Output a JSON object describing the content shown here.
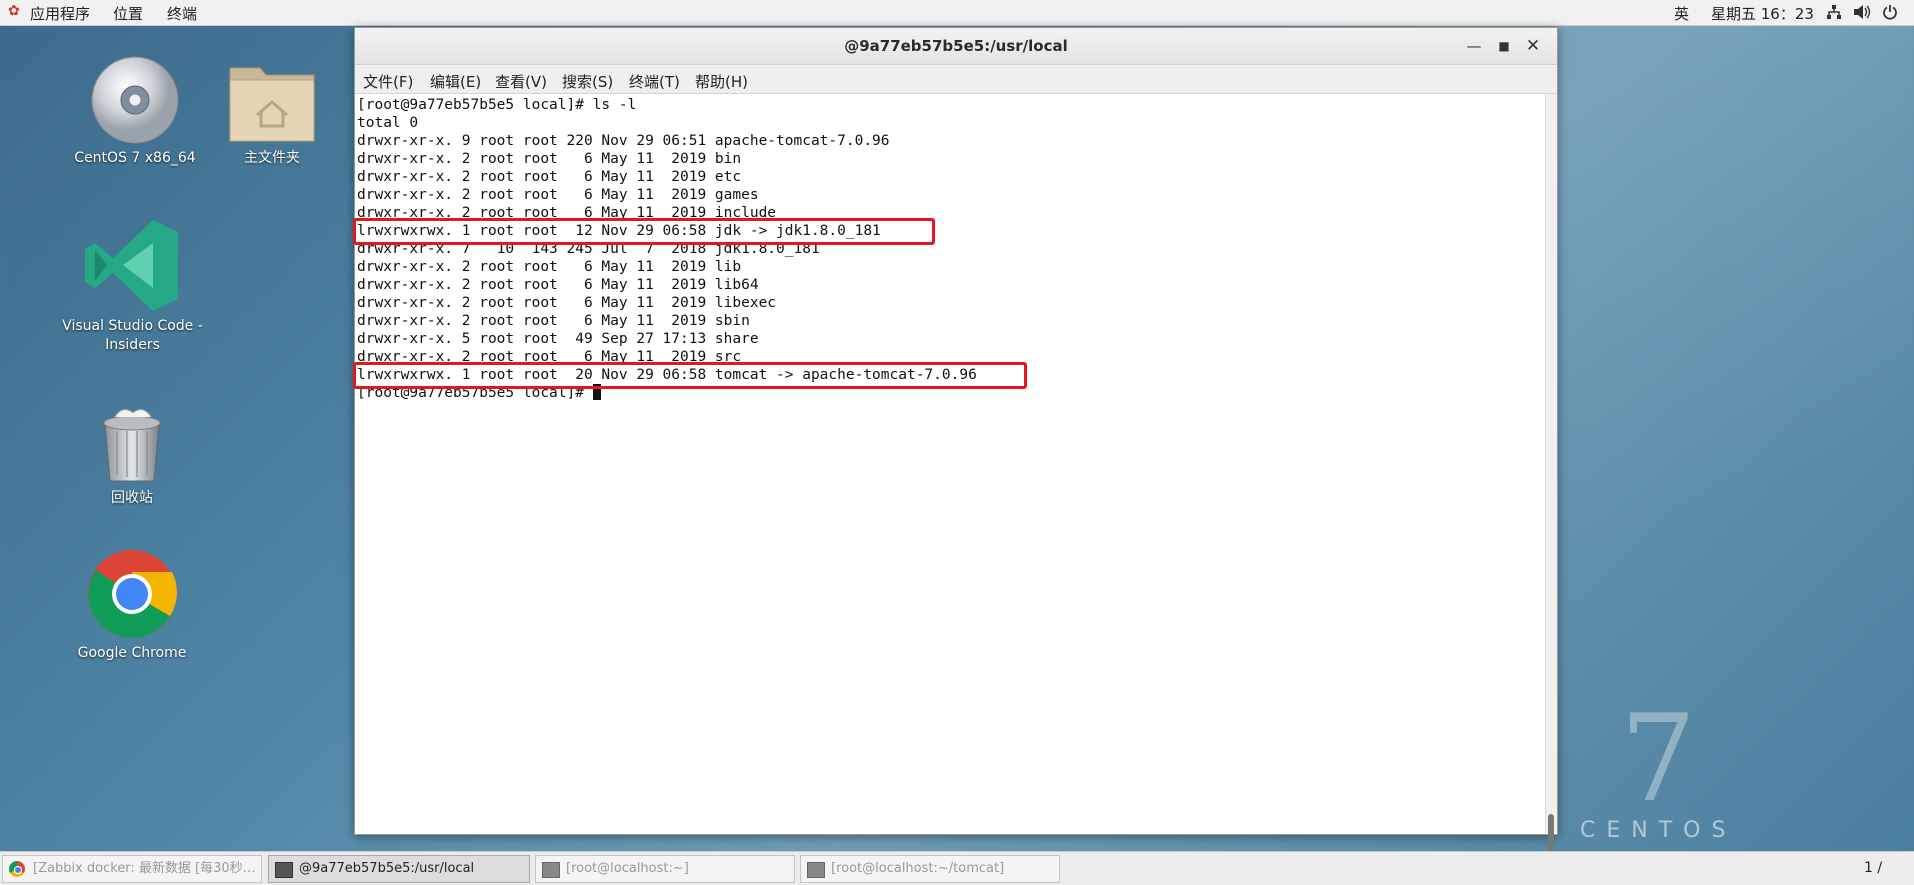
{
  "topbar": {
    "apps_label": "应用程序",
    "places_label": "位置",
    "terminal_label": "终端",
    "ime": "英",
    "clock": "星期五 16：23",
    "network_icon": "network-icon",
    "volume_icon": "volume-icon",
    "power_icon": "power-icon"
  },
  "desktop": {
    "icons": [
      {
        "label": "CentOS 7 x86_64",
        "icon": "disc-icon"
      },
      {
        "label": "主文件夹",
        "icon": "home-folder-icon"
      },
      {
        "label": "Visual Studio Code - Insiders",
        "icon": "vscode-icon"
      },
      {
        "label": "回收站",
        "icon": "trash-icon"
      },
      {
        "label": "Google Chrome",
        "icon": "chrome-icon"
      }
    ],
    "wallpaper_number": "7",
    "wallpaper_word": "CENTOS"
  },
  "window": {
    "title": "@9a77eb57b5e5:/usr/local",
    "menu": [
      "文件(F)",
      "编辑(E)",
      "查看(V)",
      "搜索(S)",
      "终端(T)",
      "帮助(H)"
    ],
    "lines": [
      "[root@9a77eb57b5e5 local]# ls -l",
      "total 0",
      "drwxr-xr-x. 9 root root 220 Nov 29 06:51 apache-tomcat-7.0.96",
      "drwxr-xr-x. 2 root root   6 May 11  2019 bin",
      "drwxr-xr-x. 2 root root   6 May 11  2019 etc",
      "drwxr-xr-x. 2 root root   6 May 11  2019 games",
      "drwxr-xr-x. 2 root root   6 May 11  2019 include",
      "lrwxrwxrwx. 1 root root  12 Nov 29 06:58 jdk -> jdk1.8.0_181",
      "drwxr-xr-x. 7   10  143 245 Jul  7  2018 jdk1.8.0_181",
      "drwxr-xr-x. 2 root root   6 May 11  2019 lib",
      "drwxr-xr-x. 2 root root   6 May 11  2019 lib64",
      "drwxr-xr-x. 2 root root   6 May 11  2019 libexec",
      "drwxr-xr-x. 2 root root   6 May 11  2019 sbin",
      "drwxr-xr-x. 5 root root  49 Sep 27 17:13 share",
      "drwxr-xr-x. 2 root root   6 May 11  2019 src",
      "lrwxrwxrwx. 1 root root  20 Nov 29 06:58 tomcat -> apache-tomcat-7.0.96",
      "[root@9a77eb57b5e5 local]# "
    ],
    "highlight_color": "#e5171c"
  },
  "taskbar": {
    "tasks": [
      {
        "label": "[Zabbix docker: 最新数据 [每30秒…",
        "active": false
      },
      {
        "label": "@9a77eb57b5e5:/usr/local",
        "active": true
      },
      {
        "label": "[root@localhost:~]",
        "active": false
      },
      {
        "label": "[root@localhost:~/tomcat]",
        "active": false
      }
    ],
    "pager": "1 /"
  }
}
